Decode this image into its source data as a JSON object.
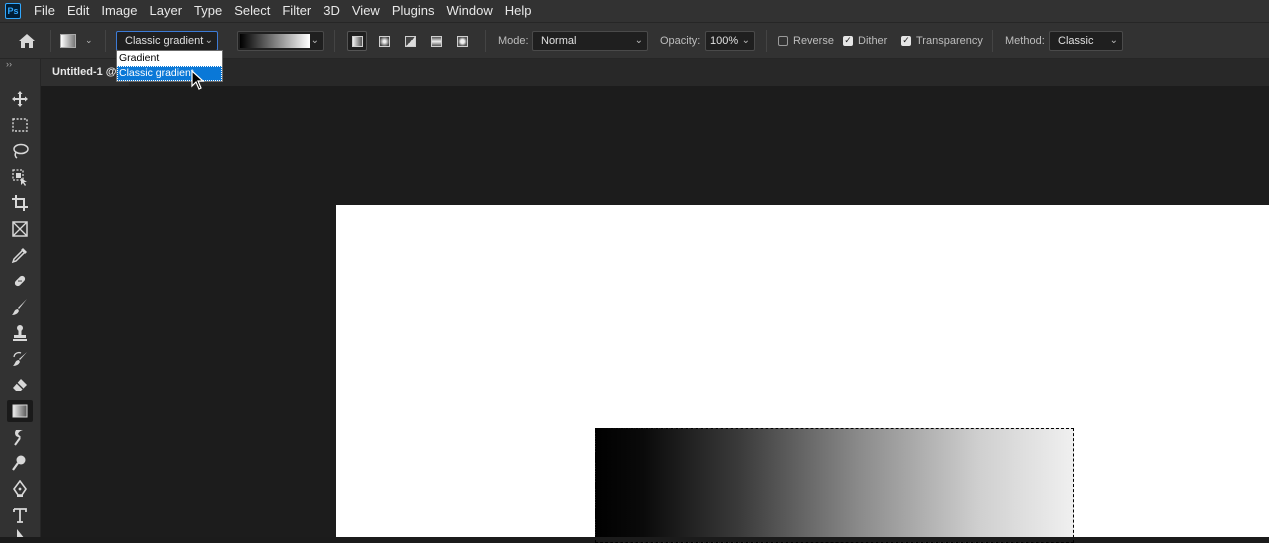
{
  "app": {
    "logo_text": "Ps",
    "menu": [
      "File",
      "Edit",
      "Image",
      "Layer",
      "Type",
      "Select",
      "Filter",
      "3D",
      "View",
      "Plugins",
      "Window",
      "Help"
    ]
  },
  "options_bar": {
    "gradient_type_value": "Classic gradient",
    "gradient_type_options": [
      "Gradient",
      "Classic gradient"
    ],
    "gradient_type_highlighted": "Classic gradient",
    "mode_label": "Mode:",
    "mode_value": "Normal",
    "opacity_label": "Opacity:",
    "opacity_value": "100%",
    "reverse_label": "Reverse",
    "reverse_checked": false,
    "dither_label": "Dither",
    "dither_checked": true,
    "transparency_label": "Transparency",
    "transparency_checked": true,
    "method_label": "Method:",
    "method_value": "Classic",
    "gradient_styles": [
      "linear",
      "radial",
      "angle",
      "reflected",
      "diamond"
    ],
    "selected_style": "linear"
  },
  "document": {
    "tab_title": "Untitled-1 @"
  },
  "toolbar": {
    "selected_tool": "gradient-tool",
    "tools": [
      "move-tool",
      "rectangular-marquee-tool",
      "lasso-tool",
      "object-selection-tool",
      "crop-tool",
      "frame-tool",
      "eyedropper-tool",
      "spot-healing-brush-tool",
      "brush-tool",
      "clone-stamp-tool",
      "history-brush-tool",
      "eraser-tool",
      "gradient-tool",
      "smudge-tool",
      "dodge-tool",
      "pen-tool",
      "type-tool",
      "path-selection-tool"
    ]
  },
  "colors": {
    "accent": "#0a78d7",
    "panel": "#323232",
    "workspace": "#1b1b1b"
  }
}
